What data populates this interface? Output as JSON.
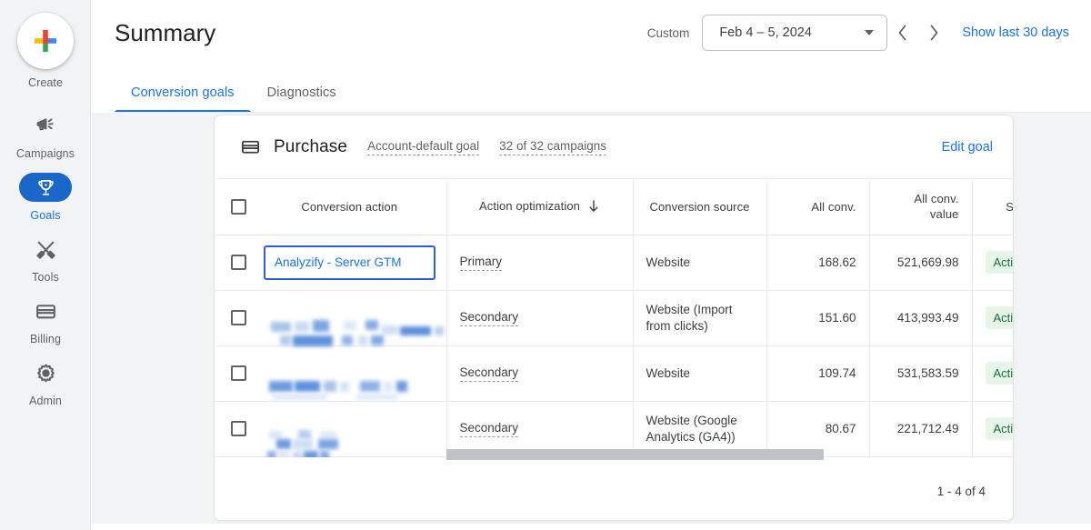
{
  "sidebar": {
    "items": [
      {
        "label": "Create",
        "icon": "plus-icon",
        "active": false
      },
      {
        "label": "Campaigns",
        "icon": "megaphone-icon",
        "active": false
      },
      {
        "label": "Goals",
        "icon": "trophy-icon",
        "active": true
      },
      {
        "label": "Tools",
        "icon": "tools-icon",
        "active": false
      },
      {
        "label": "Billing",
        "icon": "credit-card-icon",
        "active": false
      },
      {
        "label": "Admin",
        "icon": "gear-icon",
        "active": false
      }
    ]
  },
  "header": {
    "title": "Summary",
    "date_mode_label": "Custom",
    "date_range": "Feb 4 – 5, 2024",
    "prev_icon": "chevron-left-icon",
    "next_icon": "chevron-right-icon",
    "dropdown_icon": "caret-down-icon",
    "show_last_link": "Show last 30 days"
  },
  "tabs": [
    {
      "label": "Conversion goals",
      "active": true
    },
    {
      "label": "Diagnostics",
      "active": false
    }
  ],
  "card": {
    "icon": "credit-card-icon",
    "title": "Purchase",
    "default_goal_label": "Account-default goal",
    "campaigns_label": "32 of 32 campaigns",
    "edit_goal_label": "Edit goal"
  },
  "table": {
    "columns": [
      {
        "label": "Conversion action",
        "align": "left"
      },
      {
        "label": "Action optimization",
        "align": "left",
        "sort_icon": "sort-down-arrow-icon"
      },
      {
        "label": "Conversion source",
        "align": "left"
      },
      {
        "label": "All conv.",
        "align": "right"
      },
      {
        "label": "All conv. value",
        "align": "right"
      },
      {
        "label": "Status",
        "align": "left",
        "clipped": true
      }
    ],
    "rows": [
      {
        "action": "Analyzify - Server GTM",
        "action_redacted": false,
        "action_selected": true,
        "optimization": "Primary",
        "source": "Website",
        "all_conv": "168.62",
        "all_conv_value": "521,669.98",
        "status": "Active"
      },
      {
        "action": "",
        "action_redacted": true,
        "action_selected": false,
        "optimization": "Secondary",
        "source": "Website (Import from clicks)",
        "all_conv": "151.60",
        "all_conv_value": "413,993.49",
        "status": "Active"
      },
      {
        "action": "",
        "action_redacted": true,
        "action_selected": false,
        "optimization": "Secondary",
        "source": "Website",
        "all_conv": "109.74",
        "all_conv_value": "531,583.59",
        "status": "Active"
      },
      {
        "action": "",
        "action_redacted": true,
        "action_selected": false,
        "optimization": "Secondary",
        "source": "Website (Google Analytics (GA4))",
        "all_conv": "80.67",
        "all_conv_value": "221,712.49",
        "status": "Active"
      }
    ],
    "pagination": "1 - 4 of 4"
  },
  "colors": {
    "accent_blue": "#1a73e8",
    "active_pill": "#1b66c9",
    "status_bg": "#e6f4ea",
    "status_text": "#137333",
    "selection_border": "#2b5ce6",
    "page_bg": "#f1f3f4"
  }
}
